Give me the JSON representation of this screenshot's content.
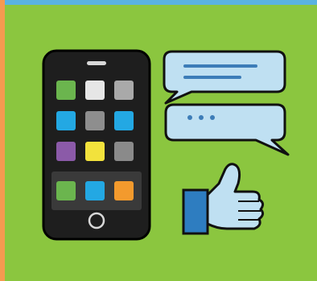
{
  "illustration": {
    "subject": "smartphone-chat-like",
    "colors": {
      "background": "#8BC63F",
      "left_stripe": "#F59A50",
      "top_band": "#5AB3E0",
      "phone_body": "#1E1E1E",
      "phone_trim": "#000000",
      "phone_dock": "#3A3A3A",
      "bubble_fill": "#BFE0F2",
      "bubble_stroke": "#111111",
      "bubble_line": "#3D7DB8",
      "thumb_fill": "#BFE0F2",
      "cuff": "#2E7DC0"
    },
    "app_tiles": [
      {
        "color": "#6BB54E"
      },
      {
        "color": "#E6E6E6"
      },
      {
        "color": "#A9A9A9"
      },
      {
        "color": "#23A8E3"
      },
      {
        "color": "#8E8E8E"
      },
      {
        "color": "#23A8E3"
      },
      {
        "color": "#8B5AA8"
      },
      {
        "color": "#F2E23C"
      },
      {
        "color": "#8A8A8A"
      }
    ],
    "dock_tiles": [
      {
        "color": "#6BB54E"
      },
      {
        "color": "#23A8E3"
      },
      {
        "color": "#F39A2D"
      }
    ]
  }
}
